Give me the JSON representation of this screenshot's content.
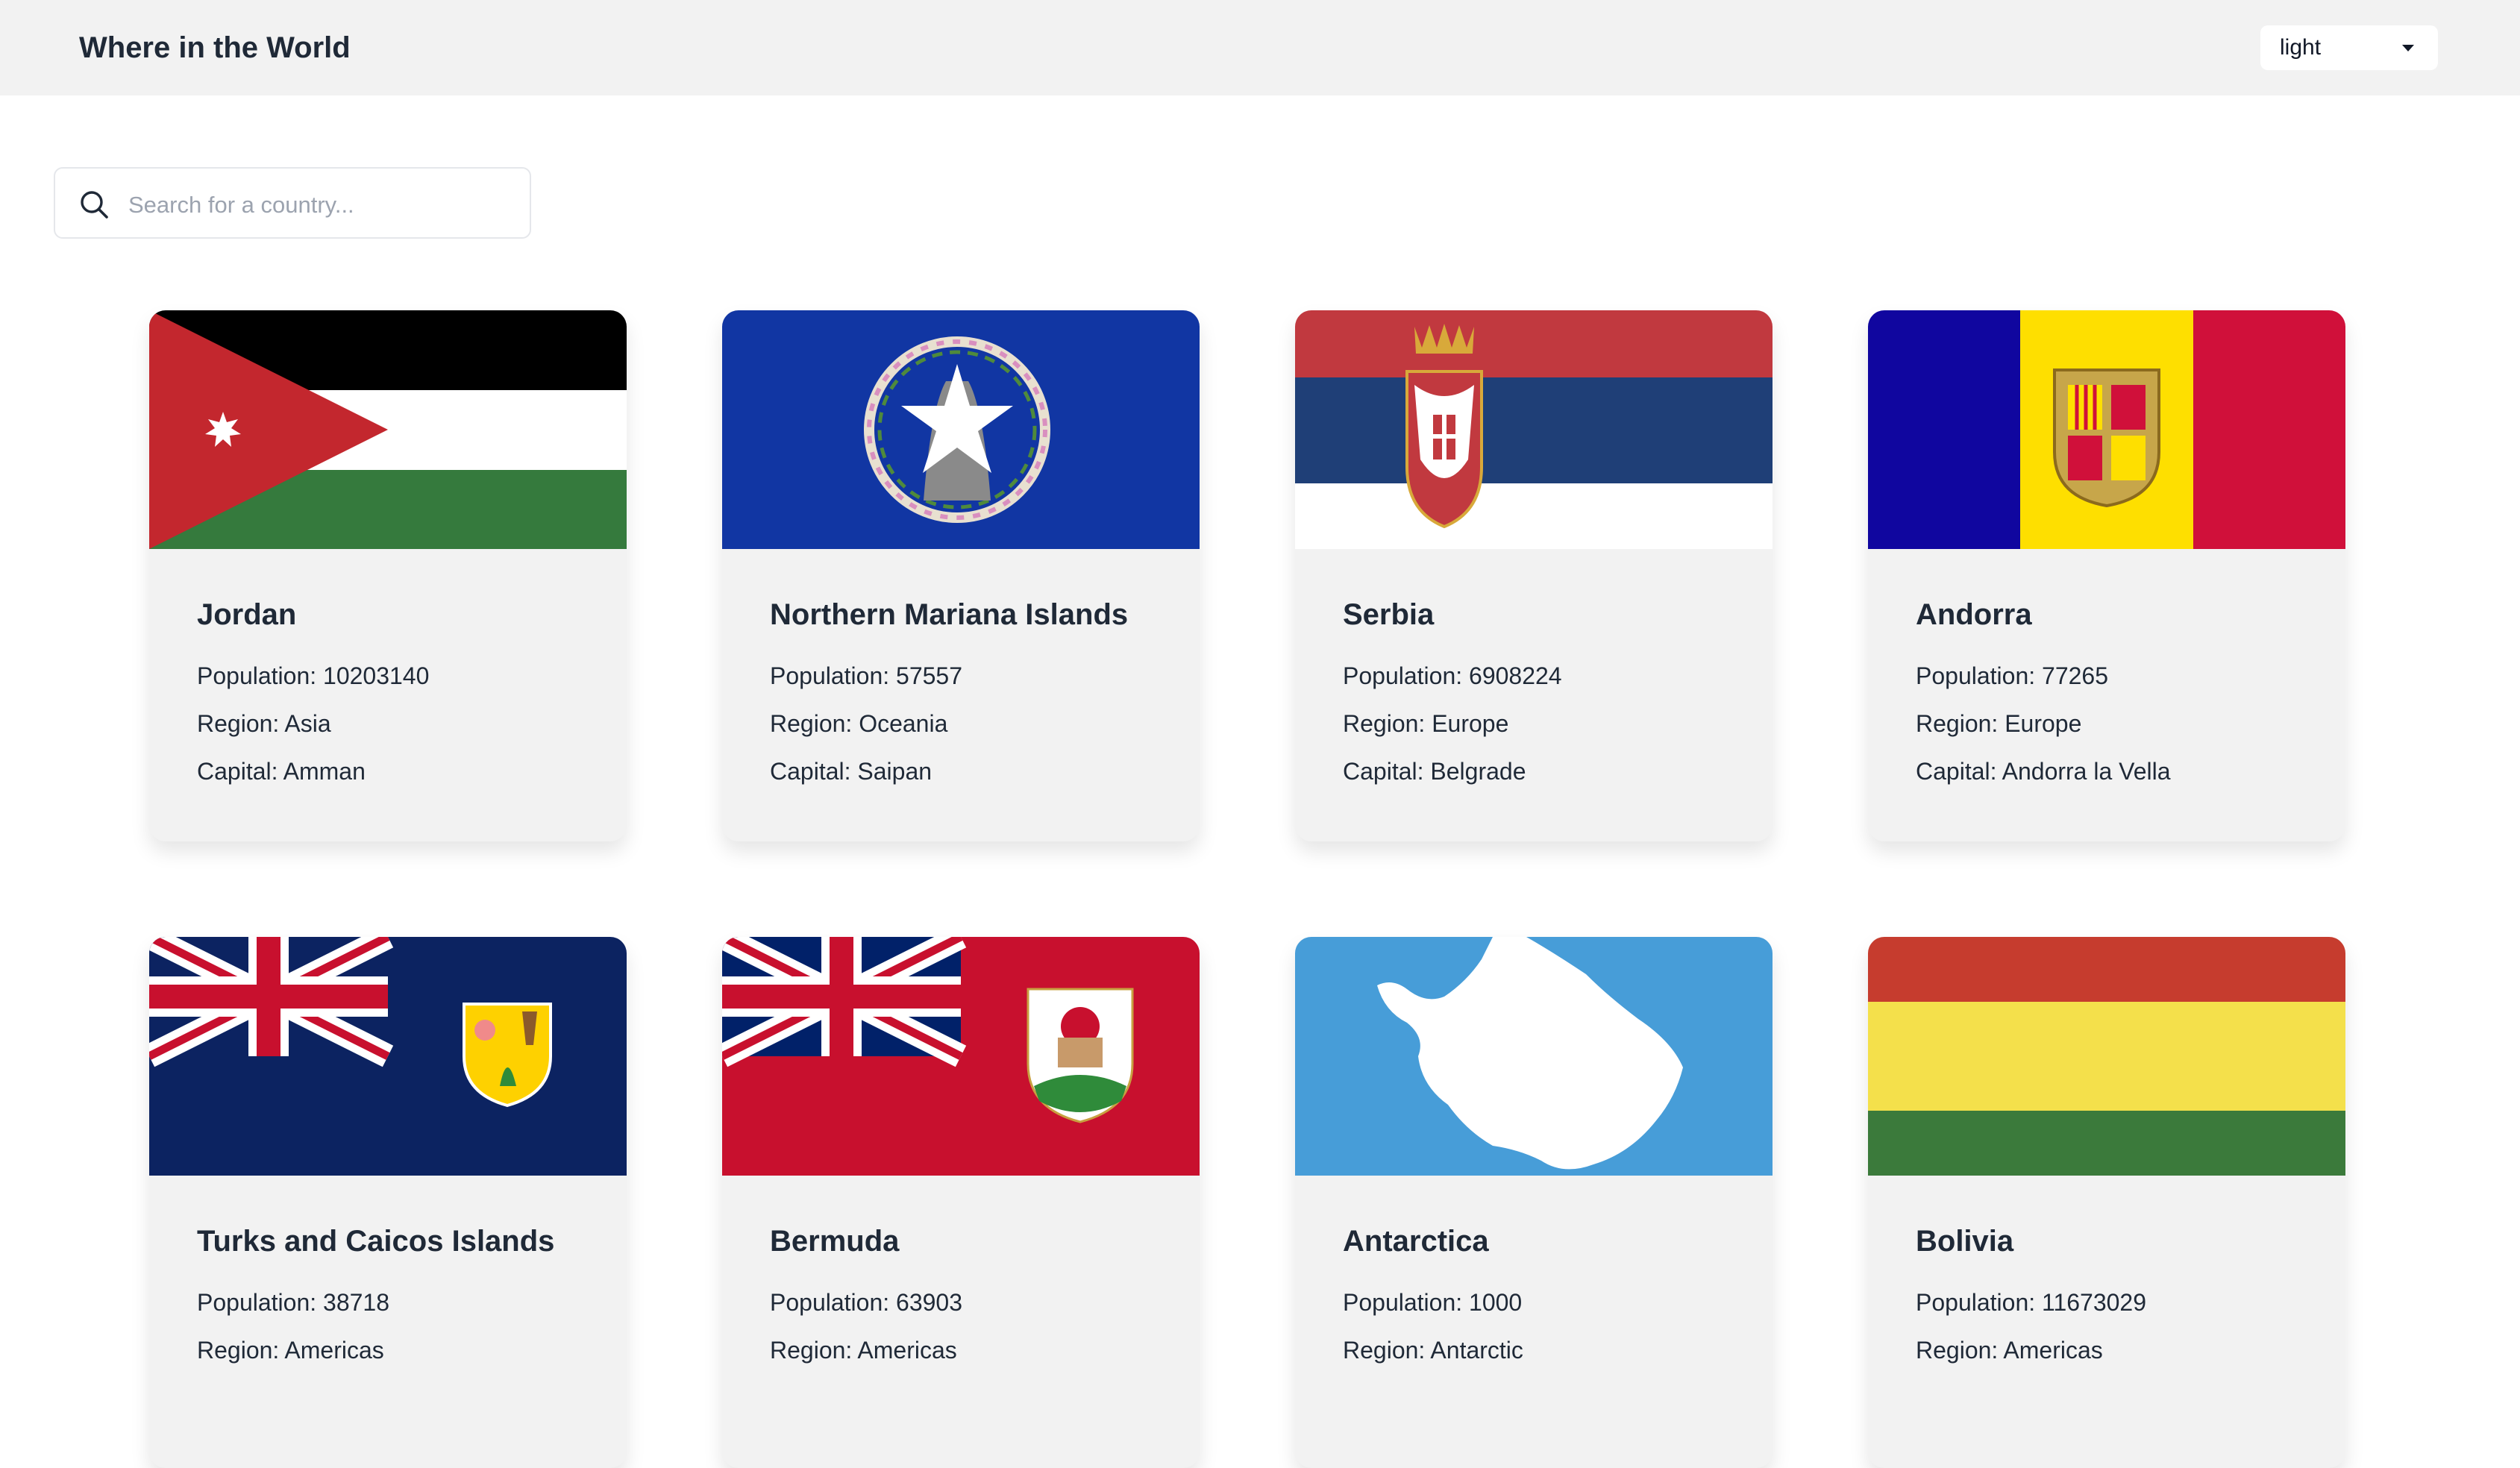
{
  "header": {
    "title": "Where in the World",
    "theme_select": {
      "selected": "light",
      "options": [
        "light"
      ]
    }
  },
  "search": {
    "placeholder": "Search for a country...",
    "value": ""
  },
  "countries": [
    {
      "name": "Jordan",
      "population": "Population: 10203140",
      "region": "Region: Asia",
      "capital": "Capital: Amman",
      "flag_icon": "jordan-flag"
    },
    {
      "name": "Northern Mariana Islands",
      "population": "Population: 57557",
      "region": "Region: Oceania",
      "capital": "Capital: Saipan",
      "flag_icon": "northern-mariana-islands-flag"
    },
    {
      "name": "Serbia",
      "population": "Population: 6908224",
      "region": "Region: Europe",
      "capital": "Capital: Belgrade",
      "flag_icon": "serbia-flag"
    },
    {
      "name": "Andorra",
      "population": "Population: 77265",
      "region": "Region: Europe",
      "capital": "Capital: Andorra la Vella",
      "flag_icon": "andorra-flag"
    },
    {
      "name": "Turks and Caicos Islands",
      "population": "Population: 38718",
      "region": "Region: Americas",
      "flag_icon": "turks-and-caicos-flag"
    },
    {
      "name": "Bermuda",
      "population": "Population: 63903",
      "region": "Region: Americas",
      "flag_icon": "bermuda-flag"
    },
    {
      "name": "Antarctica",
      "population": "Population: 1000",
      "region": "Region: Antarctic",
      "flag_icon": "antarctica-flag"
    },
    {
      "name": "Bolivia",
      "population": "Population: 11673029",
      "region": "Region: Americas",
      "flag_icon": "bolivia-flag"
    }
  ],
  "colors": {
    "header_bg": "#f2f2f2",
    "card_bg": "#f2f2f2",
    "text": "#1f2937",
    "placeholder": "#9ca3af"
  }
}
